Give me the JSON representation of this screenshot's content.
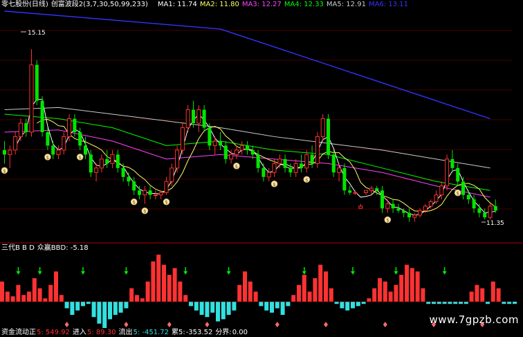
{
  "header": {
    "stock": "零七股份(日线)",
    "indicator": "创富波段2(3,7,30,50,99,233)",
    "ma1": "MA1: 11.74",
    "ma2": "MA2: 11.80",
    "ma3": "MA3: 12.27",
    "ma4": "MA4: 12.33",
    "ma5": "MA5: 12.91",
    "ma6": "MA6: 13.11"
  },
  "price_labels": {
    "high": "15.15",
    "low": "11.35"
  },
  "sub_header": {
    "title": "三代B B D",
    "value": "众赢BBD: -5.18"
  },
  "bottom_header": {
    "l1": "资金流动正",
    "v1": "5: 549.92",
    "l2": "进入",
    "v2": "5: 89.30",
    "l3": "流出",
    "v3": "5: -451.72",
    "l4": "累5:",
    "v4": "-353.52",
    "l5": "分界:",
    "v5": "0.00"
  },
  "watermark": "www.7gpzb.com",
  "colors": {
    "up": "#ff3232",
    "down": "#00e600",
    "neg_bar": "#33e0e0",
    "grid": "#8b0000",
    "ma1": "#ffffff",
    "ma2": "#ffff66",
    "ma3": "#ff44ff",
    "ma4": "#00ff00",
    "ma5": "#cccccc",
    "ma6": "#3333ff"
  },
  "chart_data": {
    "type": "candlestick",
    "price_range": [
      11.0,
      16.0
    ],
    "candles": [
      {
        "o": 12.9,
        "h": 13.1,
        "l": 12.6,
        "c": 12.8
      },
      {
        "o": 12.8,
        "h": 13.0,
        "l": 12.5,
        "c": 12.9
      },
      {
        "o": 12.9,
        "h": 13.3,
        "l": 12.8,
        "c": 13.2
      },
      {
        "o": 13.2,
        "h": 13.6,
        "l": 13.1,
        "c": 13.5
      },
      {
        "o": 13.5,
        "h": 13.6,
        "l": 13.2,
        "c": 13.3
      },
      {
        "o": 13.3,
        "h": 15.15,
        "l": 13.2,
        "c": 14.8
      },
      {
        "o": 14.8,
        "h": 14.9,
        "l": 13.9,
        "c": 14.0
      },
      {
        "o": 14.0,
        "h": 14.1,
        "l": 13.2,
        "c": 13.3
      },
      {
        "o": 13.3,
        "h": 13.4,
        "l": 12.9,
        "c": 13.0
      },
      {
        "o": 13.0,
        "h": 13.1,
        "l": 12.7,
        "c": 12.8
      },
      {
        "o": 12.8,
        "h": 13.0,
        "l": 12.7,
        "c": 12.9
      },
      {
        "o": 12.9,
        "h": 13.3,
        "l": 12.8,
        "c": 13.2
      },
      {
        "o": 13.2,
        "h": 13.7,
        "l": 13.1,
        "c": 13.6
      },
      {
        "o": 13.6,
        "h": 13.7,
        "l": 13.2,
        "c": 13.3
      },
      {
        "o": 13.3,
        "h": 13.4,
        "l": 12.9,
        "c": 13.0
      },
      {
        "o": 13.0,
        "h": 13.2,
        "l": 12.7,
        "c": 12.8
      },
      {
        "o": 12.8,
        "h": 12.9,
        "l": 12.3,
        "c": 12.4
      },
      {
        "o": 12.4,
        "h": 12.6,
        "l": 12.2,
        "c": 12.5
      },
      {
        "o": 12.5,
        "h": 12.8,
        "l": 12.4,
        "c": 12.7
      },
      {
        "o": 12.7,
        "h": 12.9,
        "l": 12.5,
        "c": 12.6
      },
      {
        "o": 12.6,
        "h": 12.9,
        "l": 12.5,
        "c": 12.8
      },
      {
        "o": 12.8,
        "h": 12.9,
        "l": 12.4,
        "c": 12.5
      },
      {
        "o": 12.5,
        "h": 12.6,
        "l": 12.2,
        "c": 12.3
      },
      {
        "o": 12.3,
        "h": 12.4,
        "l": 12.1,
        "c": 12.2
      },
      {
        "o": 12.2,
        "h": 12.3,
        "l": 11.9,
        "c": 12.0
      },
      {
        "o": 12.0,
        "h": 12.1,
        "l": 11.8,
        "c": 11.9
      },
      {
        "o": 11.9,
        "h": 12.1,
        "l": 11.7,
        "c": 12.0
      },
      {
        "o": 12.0,
        "h": 12.1,
        "l": 11.8,
        "c": 11.9
      },
      {
        "o": 11.9,
        "h": 12.0,
        "l": 11.8,
        "c": 11.9
      },
      {
        "o": 11.9,
        "h": 12.0,
        "l": 11.8,
        "c": 11.95
      },
      {
        "o": 11.95,
        "h": 12.3,
        "l": 11.9,
        "c": 12.2
      },
      {
        "o": 12.2,
        "h": 12.6,
        "l": 12.1,
        "c": 12.5
      },
      {
        "o": 12.5,
        "h": 13.0,
        "l": 12.4,
        "c": 12.9
      },
      {
        "o": 12.9,
        "h": 13.5,
        "l": 12.8,
        "c": 13.4
      },
      {
        "o": 13.4,
        "h": 13.9,
        "l": 13.3,
        "c": 13.8
      },
      {
        "o": 13.8,
        "h": 14.0,
        "l": 13.4,
        "c": 13.5
      },
      {
        "o": 13.5,
        "h": 13.9,
        "l": 13.3,
        "c": 13.8
      },
      {
        "o": 13.8,
        "h": 13.9,
        "l": 13.3,
        "c": 13.4
      },
      {
        "o": 13.4,
        "h": 13.5,
        "l": 12.9,
        "c": 13.0
      },
      {
        "o": 13.0,
        "h": 13.2,
        "l": 12.8,
        "c": 13.1
      },
      {
        "o": 13.1,
        "h": 13.3,
        "l": 12.9,
        "c": 13.0
      },
      {
        "o": 13.0,
        "h": 13.1,
        "l": 12.6,
        "c": 12.7
      },
      {
        "o": 12.7,
        "h": 12.9,
        "l": 12.6,
        "c": 12.8
      },
      {
        "o": 12.8,
        "h": 13.0,
        "l": 12.7,
        "c": 12.9
      },
      {
        "o": 12.9,
        "h": 13.1,
        "l": 12.8,
        "c": 13.0
      },
      {
        "o": 13.0,
        "h": 13.1,
        "l": 12.8,
        "c": 12.9
      },
      {
        "o": 12.9,
        "h": 13.0,
        "l": 12.7,
        "c": 12.8
      },
      {
        "o": 12.8,
        "h": 12.9,
        "l": 12.4,
        "c": 12.5
      },
      {
        "o": 12.5,
        "h": 12.6,
        "l": 12.2,
        "c": 12.3
      },
      {
        "o": 12.3,
        "h": 12.5,
        "l": 12.2,
        "c": 12.4
      },
      {
        "o": 12.4,
        "h": 12.7,
        "l": 12.3,
        "c": 12.6
      },
      {
        "o": 12.6,
        "h": 12.8,
        "l": 12.5,
        "c": 12.7
      },
      {
        "o": 12.7,
        "h": 12.8,
        "l": 12.4,
        "c": 12.5
      },
      {
        "o": 12.5,
        "h": 12.6,
        "l": 12.3,
        "c": 12.4
      },
      {
        "o": 12.4,
        "h": 12.7,
        "l": 12.3,
        "c": 12.6
      },
      {
        "o": 12.6,
        "h": 12.8,
        "l": 12.4,
        "c": 12.5
      },
      {
        "o": 12.5,
        "h": 12.9,
        "l": 12.4,
        "c": 12.8
      },
      {
        "o": 12.8,
        "h": 13.0,
        "l": 12.5,
        "c": 12.6
      },
      {
        "o": 12.6,
        "h": 13.3,
        "l": 12.5,
        "c": 13.2
      },
      {
        "o": 13.2,
        "h": 13.7,
        "l": 13.1,
        "c": 13.6
      },
      {
        "o": 13.6,
        "h": 13.7,
        "l": 12.7,
        "c": 12.8
      },
      {
        "o": 12.8,
        "h": 12.9,
        "l": 12.3,
        "c": 12.4
      },
      {
        "o": 12.4,
        "h": 12.6,
        "l": 12.2,
        "c": 12.5
      },
      {
        "o": 12.5,
        "h": 12.6,
        "l": 11.9,
        "c": 12.0
      },
      {
        "o": 12.0,
        "h": 12.1,
        "l": 11.9,
        "c": 11.95
      },
      {
        "o": 11.95,
        "h": 12.0,
        "l": 11.9,
        "c": 11.95
      },
      {
        "o": 11.6,
        "h": 11.7,
        "l": 11.6,
        "c": 11.65
      },
      {
        "o": 11.95,
        "h": 12.0,
        "l": 11.9,
        "c": 12.0
      },
      {
        "o": 12.0,
        "h": 12.1,
        "l": 11.9,
        "c": 12.05
      },
      {
        "o": 12.05,
        "h": 12.1,
        "l": 11.9,
        "c": 12.0
      },
      {
        "o": 12.0,
        "h": 12.1,
        "l": 11.5,
        "c": 11.6
      },
      {
        "o": 11.6,
        "h": 11.8,
        "l": 11.5,
        "c": 11.7
      },
      {
        "o": 11.7,
        "h": 11.8,
        "l": 11.5,
        "c": 11.6
      },
      {
        "o": 11.6,
        "h": 11.7,
        "l": 11.5,
        "c": 11.55
      },
      {
        "o": 11.55,
        "h": 11.6,
        "l": 11.4,
        "c": 11.5
      },
      {
        "o": 11.5,
        "h": 11.6,
        "l": 11.3,
        "c": 11.4
      },
      {
        "o": 11.4,
        "h": 11.5,
        "l": 11.3,
        "c": 11.45
      },
      {
        "o": 11.45,
        "h": 11.6,
        "l": 11.4,
        "c": 11.55
      },
      {
        "o": 11.55,
        "h": 11.7,
        "l": 11.5,
        "c": 11.65
      },
      {
        "o": 11.65,
        "h": 11.8,
        "l": 11.6,
        "c": 11.75
      },
      {
        "o": 11.75,
        "h": 12.0,
        "l": 11.7,
        "c": 11.9
      },
      {
        "o": 11.9,
        "h": 12.2,
        "l": 11.8,
        "c": 12.1
      },
      {
        "o": 12.1,
        "h": 12.8,
        "l": 12.0,
        "c": 12.7
      },
      {
        "o": 12.7,
        "h": 12.9,
        "l": 12.4,
        "c": 12.5
      },
      {
        "o": 12.5,
        "h": 12.6,
        "l": 12.1,
        "c": 12.2
      },
      {
        "o": 12.2,
        "h": 12.3,
        "l": 11.8,
        "c": 11.9
      },
      {
        "o": 11.9,
        "h": 12.0,
        "l": 11.7,
        "c": 11.8
      },
      {
        "o": 11.8,
        "h": 11.9,
        "l": 11.5,
        "c": 11.6
      },
      {
        "o": 11.6,
        "h": 11.7,
        "l": 11.4,
        "c": 11.5
      },
      {
        "o": 11.5,
        "h": 11.6,
        "l": 11.35,
        "c": 11.4
      },
      {
        "o": 11.4,
        "h": 11.7,
        "l": 11.35,
        "c": 11.65
      },
      {
        "o": 11.65,
        "h": 11.8,
        "l": 11.5,
        "c": 11.55
      }
    ],
    "signals": [
      {
        "i": 0,
        "label": "$"
      },
      {
        "i": 8,
        "label": "$"
      },
      {
        "i": 14,
        "label": "$"
      },
      {
        "i": 24,
        "label": "$"
      },
      {
        "i": 26,
        "label": "$"
      },
      {
        "i": 30,
        "label": "$"
      },
      {
        "i": 43,
        "label": "$"
      },
      {
        "i": 50,
        "label": "$"
      },
      {
        "i": 56,
        "label": "$"
      },
      {
        "i": 71,
        "label": "$"
      },
      {
        "i": 84,
        "label": "$"
      }
    ],
    "ma_lines": [
      {
        "key": "ma3",
        "pts": [
          [
            0,
            13.3
          ],
          [
            10,
            13.35
          ],
          [
            20,
            13.1
          ],
          [
            30,
            12.7
          ],
          [
            40,
            12.8
          ],
          [
            50,
            12.7
          ],
          [
            60,
            12.6
          ],
          [
            70,
            12.4
          ],
          [
            80,
            12.1
          ],
          [
            90,
            11.85
          ]
        ]
      },
      {
        "key": "ma4",
        "pts": [
          [
            0,
            13.7
          ],
          [
            10,
            13.6
          ],
          [
            20,
            13.4
          ],
          [
            30,
            13.0
          ],
          [
            40,
            13.1
          ],
          [
            50,
            12.9
          ],
          [
            60,
            12.8
          ],
          [
            70,
            12.5
          ],
          [
            80,
            12.2
          ],
          [
            90,
            12.0
          ]
        ]
      },
      {
        "key": "ma5",
        "pts": [
          [
            0,
            13.8
          ],
          [
            10,
            13.85
          ],
          [
            20,
            13.7
          ],
          [
            30,
            13.55
          ],
          [
            40,
            13.4
          ],
          [
            50,
            13.2
          ],
          [
            60,
            13.05
          ],
          [
            70,
            12.9
          ],
          [
            80,
            12.7
          ],
          [
            90,
            12.5
          ]
        ]
      },
      {
        "key": "ma6",
        "pts": [
          [
            0,
            16.0
          ],
          [
            20,
            15.8
          ],
          [
            40,
            15.6
          ],
          [
            50,
            15.2
          ],
          [
            60,
            14.8
          ],
          [
            70,
            14.4
          ],
          [
            80,
            14.0
          ],
          [
            90,
            13.6
          ]
        ]
      }
    ],
    "bbd_range": [
      -60,
      100
    ],
    "bbd": [
      30,
      15,
      8,
      25,
      10,
      15,
      35,
      20,
      5,
      25,
      45,
      10,
      -15,
      -30,
      -20,
      -10,
      -5,
      -35,
      -50,
      -60,
      -40,
      -30,
      -25,
      -15,
      20,
      10,
      5,
      30,
      60,
      70,
      55,
      40,
      50,
      30,
      10,
      -10,
      -20,
      -30,
      -35,
      -25,
      -45,
      -40,
      -30,
      -20,
      25,
      45,
      30,
      15,
      -10,
      -20,
      -25,
      -15,
      -30,
      -10,
      10,
      25,
      40,
      15,
      35,
      55,
      45,
      20,
      -5,
      -15,
      -20,
      -15,
      -10,
      -5,
      5,
      20,
      35,
      30,
      15,
      25,
      40,
      55,
      50,
      45,
      20,
      -5,
      -5,
      -5,
      -5,
      -5,
      -5,
      -5,
      -5,
      15,
      25,
      20,
      -5,
      30,
      20,
      -5,
      -5,
      -5
    ],
    "bbd_arrows": [
      3,
      7,
      15,
      23,
      34,
      42,
      56,
      65,
      73,
      82
    ],
    "bbd_diamonds": [
      12,
      23,
      31,
      38,
      51,
      60,
      71,
      80,
      89
    ]
  }
}
